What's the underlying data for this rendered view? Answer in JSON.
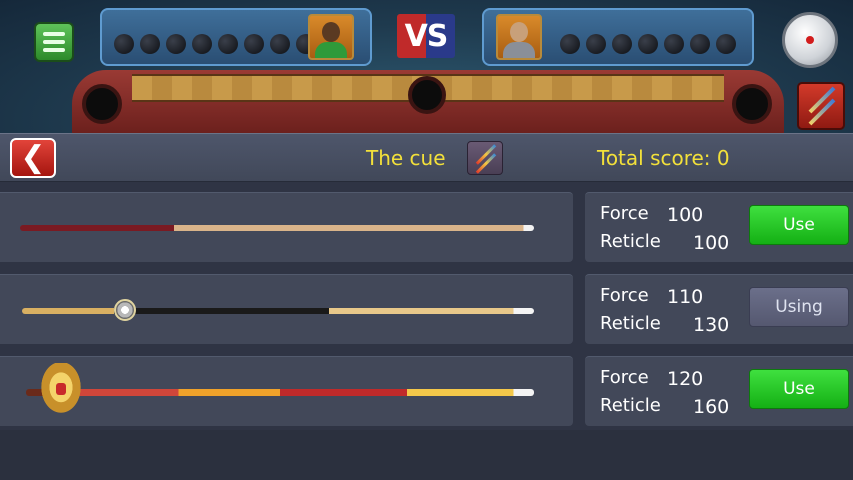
{
  "hud": {
    "vs_label": "VS"
  },
  "shop": {
    "title": "The cue",
    "total_score": "Total score: 0"
  },
  "cues": [
    {
      "force_label": "Force",
      "force": "100",
      "reticle_label": "Reticle",
      "reticle": "100",
      "button": "Use",
      "state": "use"
    },
    {
      "force_label": "Force",
      "force": "110",
      "reticle_label": "Reticle",
      "reticle": "130",
      "button": "Using",
      "state": "using"
    },
    {
      "force_label": "Force",
      "force": "120",
      "reticle_label": "Reticle",
      "reticle": "160",
      "button": "Use",
      "state": "use"
    }
  ],
  "colors": {
    "accent_text": "#f2e03a",
    "use_button": "#22c522",
    "using_button": "#5f627c",
    "back_button": "#d32a22"
  },
  "icons": [
    "menu-icon",
    "cue-ball-icon",
    "cue-shop-icon",
    "back-arrow-icon",
    "cue-icon"
  ]
}
